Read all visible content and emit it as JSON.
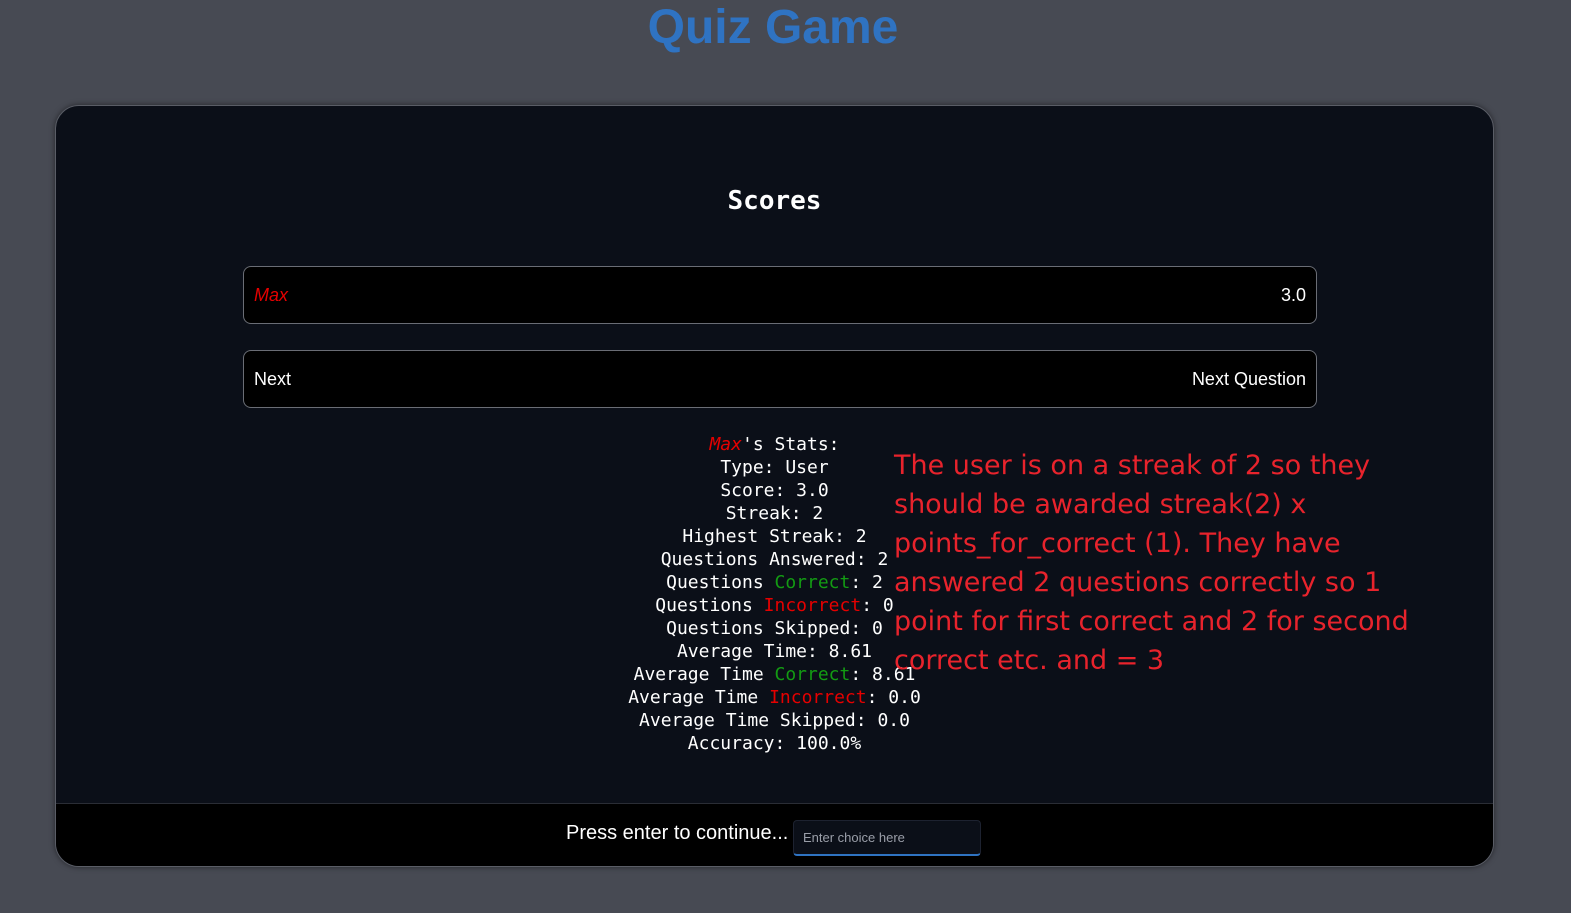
{
  "app": {
    "title": "Quiz Game"
  },
  "scores": {
    "heading": "Scores",
    "player_name": "Max",
    "player_score": "3.0",
    "next_label": "Next",
    "next_action": "Next Question"
  },
  "stats": {
    "name": "Max",
    "name_suffix": "'s Stats:",
    "type": "Type: User",
    "score": "Score: 3.0",
    "streak": "Streak: 2",
    "highest_streak": "Highest Streak: 2",
    "questions_answered": "Questions Answered: 2",
    "questions_correct_prefix": "Questions ",
    "questions_correct_word": "Correct",
    "questions_correct_value": ": 2",
    "questions_incorrect_prefix": "Questions ",
    "questions_incorrect_word": "Incorrect",
    "questions_incorrect_value": ": 0",
    "questions_skipped": "Questions Skipped: 0",
    "average_time": "Average Time: 8.61",
    "avg_correct_prefix": "Average Time ",
    "avg_correct_word": "Correct",
    "avg_correct_value": ": 8.61",
    "avg_incorrect_prefix": "Average Time ",
    "avg_incorrect_word": "Incorrect",
    "avg_incorrect_value": ": 0.0",
    "avg_skipped": "Average Time Skipped: 0.0",
    "accuracy": "Accuracy: 100.0%"
  },
  "annotation": {
    "text": "The user is on a streak of 2 so they should be awarded streak(2) x points_for_correct (1). They have answered 2 questions correctly so 1 point for first correct and 2 for second correct etc. and = 3"
  },
  "footer": {
    "prompt": "Press enter to continue...",
    "input_placeholder": "Enter choice here",
    "input_value": ""
  },
  "colors": {
    "background": "#474a53",
    "panel": "#0b0f18",
    "title": "#2f73c2",
    "player_name": "#e50000",
    "correct": "#139b13",
    "incorrect": "#e50000",
    "annotation": "#e8232c"
  }
}
